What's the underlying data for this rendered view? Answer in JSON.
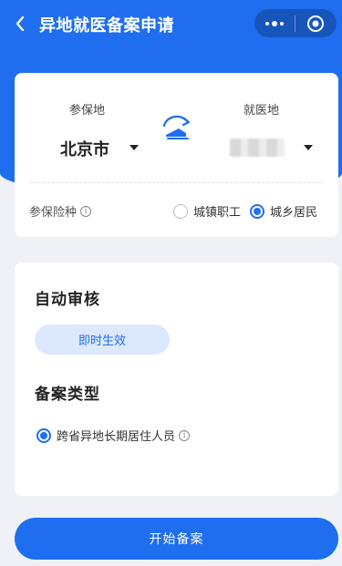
{
  "nav": {
    "title": "异地就医备案申请",
    "back_icon": "chevron-left-icon",
    "menu_icon": "more-dots-icon",
    "close_icon": "target-icon"
  },
  "location": {
    "insured_label": "参保地",
    "insured_value": "北京市",
    "treatment_label": "就医地",
    "treatment_value": "",
    "swap_icon": "swap-icon"
  },
  "insurance": {
    "label": "参保险种",
    "options": [
      {
        "label": "城镇职工",
        "checked": false
      },
      {
        "label": "城乡居民",
        "checked": true
      }
    ]
  },
  "review": {
    "title": "自动审核",
    "pill": "即时生效"
  },
  "filing_type": {
    "title": "备案类型",
    "option": "跨省异地长期居住人员",
    "checked": true
  },
  "start_button": "开始备案",
  "colors": {
    "primary": "#1f6ef0",
    "pill_bg": "#dce8fb",
    "page_bg": "#eff1f6"
  }
}
